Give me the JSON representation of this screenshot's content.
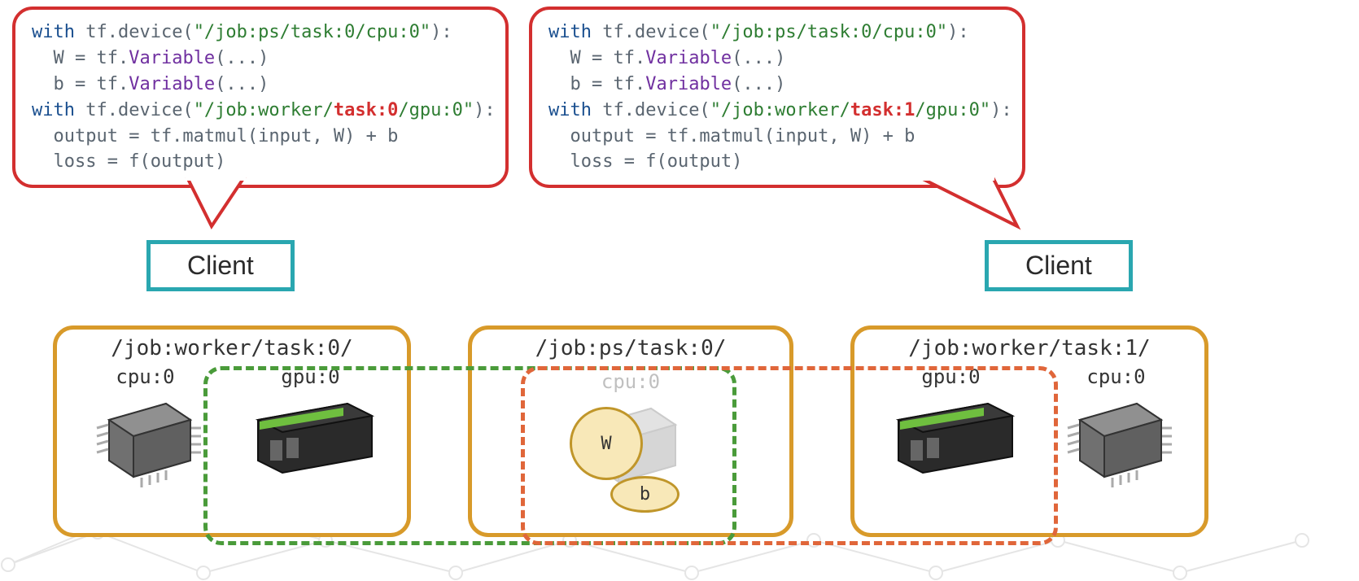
{
  "bubbleLeft": {
    "line1_pre": "with",
    "line1_device": " tf.device(",
    "line1_str": "\"/job:ps/task:0/cpu:0\"",
    "line1_post": "):",
    "line2_pre": "  W = tf.",
    "line2_fn": "Variable",
    "line2_post": "(...)",
    "line3_pre": "  b = tf.",
    "line3_fn": "Variable",
    "line3_post": "(...)",
    "line4_pre": "with",
    "line4_device": " tf.device(",
    "line4_str_a": "\"/job:worker/",
    "line4_hl": "task:0",
    "line4_str_b": "/gpu:0\"",
    "line4_post": "):",
    "line5": "  output = tf.matmul(input, W) + b",
    "line6": "  loss = f(output)"
  },
  "bubbleRight": {
    "line1_pre": "with",
    "line1_device": " tf.device(",
    "line1_str": "\"/job:ps/task:0/cpu:0\"",
    "line1_post": "):",
    "line2_pre": "  W = tf.",
    "line2_fn": "Variable",
    "line2_post": "(...)",
    "line3_pre": "  b = tf.",
    "line3_fn": "Variable",
    "line3_post": "(...)",
    "line4_pre": "with",
    "line4_device": " tf.device(",
    "line4_str_a": "\"/job:worker/",
    "line4_hl": "task:1",
    "line4_str_b": "/gpu:0\"",
    "line4_post": "):",
    "line5": "  output = tf.matmul(input, W) + b",
    "line6": "  loss = f(output)"
  },
  "clientLeft": "Client",
  "clientRight": "Client",
  "worker0": {
    "title": "/job:worker/task:0/",
    "cpu": "cpu:0",
    "gpu": "gpu:0"
  },
  "ps": {
    "title": "/job:ps/task:0/",
    "cpu": "cpu:0",
    "varW": "W",
    "varb": "b"
  },
  "worker1": {
    "title": "/job:worker/task:1/",
    "cpu": "cpu:0",
    "gpu": "gpu:0"
  },
  "colors": {
    "greenDash": "#4a9b3a",
    "orangeDash": "#e0663a"
  }
}
